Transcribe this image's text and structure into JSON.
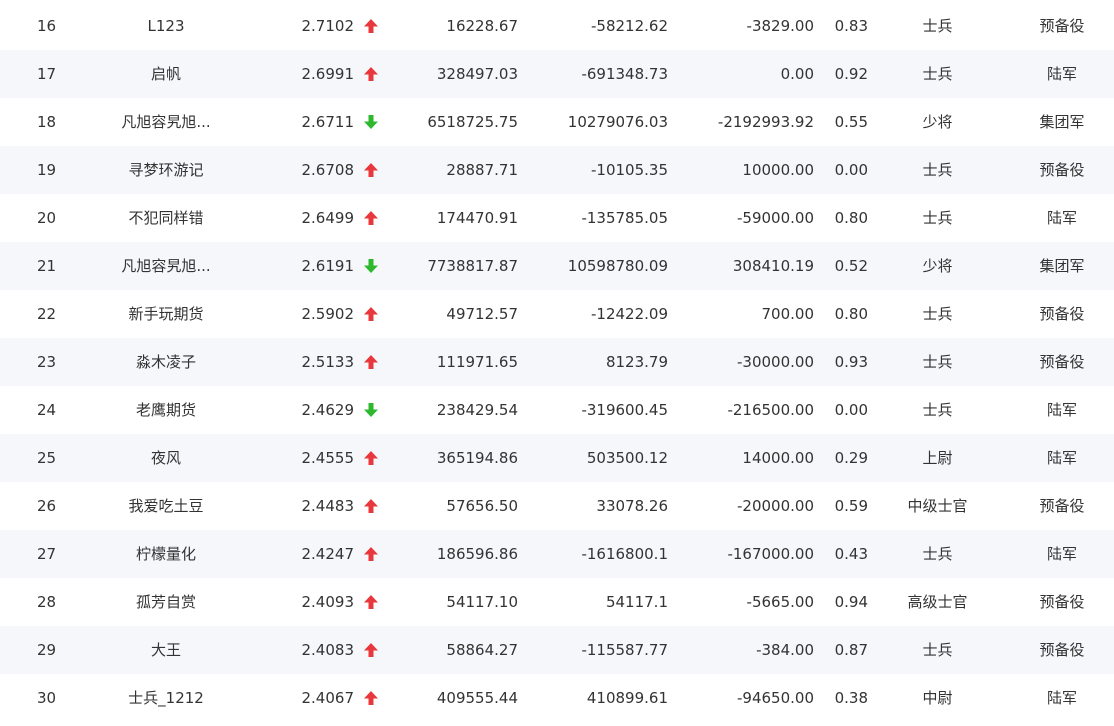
{
  "colors": {
    "up": "#e8383d",
    "down": "#2eb82e",
    "text": "#333333",
    "stripe": "#f5f7fa"
  },
  "rows": [
    {
      "rank": "16",
      "name": "L123",
      "score": "2.7102",
      "trend": "up",
      "trend_icon": "arrow-up-icon",
      "v1": "16228.67",
      "v2": "-58212.62",
      "v3": "-3829.00",
      "ratio": "0.83",
      "title": "士兵",
      "unit": "预备役"
    },
    {
      "rank": "17",
      "name": "启帆",
      "score": "2.6991",
      "trend": "up",
      "trend_icon": "arrow-up-icon",
      "v1": "328497.03",
      "v2": "-691348.73",
      "v3": "0.00",
      "ratio": "0.92",
      "title": "士兵",
      "unit": "陆军"
    },
    {
      "rank": "18",
      "name": "凡旭容旯旭...",
      "score": "2.6711",
      "trend": "down",
      "trend_icon": "arrow-down-icon",
      "v1": "6518725.75",
      "v2": "10279076.03",
      "v3": "-2192993.92",
      "ratio": "0.55",
      "title": "少将",
      "unit": "集团军"
    },
    {
      "rank": "19",
      "name": "寻梦环游记",
      "score": "2.6708",
      "trend": "up",
      "trend_icon": "arrow-up-icon",
      "v1": "28887.71",
      "v2": "-10105.35",
      "v3": "10000.00",
      "ratio": "0.00",
      "title": "士兵",
      "unit": "预备役"
    },
    {
      "rank": "20",
      "name": "不犯同样错",
      "score": "2.6499",
      "trend": "up",
      "trend_icon": "arrow-up-icon",
      "v1": "174470.91",
      "v2": "-135785.05",
      "v3": "-59000.00",
      "ratio": "0.80",
      "title": "士兵",
      "unit": "陆军"
    },
    {
      "rank": "21",
      "name": "凡旭容旯旭...",
      "score": "2.6191",
      "trend": "down",
      "trend_icon": "arrow-down-icon",
      "v1": "7738817.87",
      "v2": "10598780.09",
      "v3": "308410.19",
      "ratio": "0.52",
      "title": "少将",
      "unit": "集团军"
    },
    {
      "rank": "22",
      "name": "新手玩期货",
      "score": "2.5902",
      "trend": "up",
      "trend_icon": "arrow-up-icon",
      "v1": "49712.57",
      "v2": "-12422.09",
      "v3": "700.00",
      "ratio": "0.80",
      "title": "士兵",
      "unit": "预备役"
    },
    {
      "rank": "23",
      "name": "淼木凌子",
      "score": "2.5133",
      "trend": "up",
      "trend_icon": "arrow-up-icon",
      "v1": "111971.65",
      "v2": "8123.79",
      "v3": "-30000.00",
      "ratio": "0.93",
      "title": "士兵",
      "unit": "预备役"
    },
    {
      "rank": "24",
      "name": "老鹰期货",
      "score": "2.4629",
      "trend": "down",
      "trend_icon": "arrow-down-icon",
      "v1": "238429.54",
      "v2": "-319600.45",
      "v3": "-216500.00",
      "ratio": "0.00",
      "title": "士兵",
      "unit": "陆军"
    },
    {
      "rank": "25",
      "name": "夜风",
      "score": "2.4555",
      "trend": "up",
      "trend_icon": "arrow-up-icon",
      "v1": "365194.86",
      "v2": "503500.12",
      "v3": "14000.00",
      "ratio": "0.29",
      "title": "上尉",
      "unit": "陆军"
    },
    {
      "rank": "26",
      "name": "我爱吃土豆",
      "score": "2.4483",
      "trend": "up",
      "trend_icon": "arrow-up-icon",
      "v1": "57656.50",
      "v2": "33078.26",
      "v3": "-20000.00",
      "ratio": "0.59",
      "title": "中级士官",
      "unit": "预备役"
    },
    {
      "rank": "27",
      "name": "柠檬量化",
      "score": "2.4247",
      "trend": "up",
      "trend_icon": "arrow-up-icon",
      "v1": "186596.86",
      "v2": "-1616800.1",
      "v3": "-167000.00",
      "ratio": "0.43",
      "title": "士兵",
      "unit": "陆军"
    },
    {
      "rank": "28",
      "name": "孤芳自赏",
      "score": "2.4093",
      "trend": "up",
      "trend_icon": "arrow-up-icon",
      "v1": "54117.10",
      "v2": "54117.1",
      "v3": "-5665.00",
      "ratio": "0.94",
      "title": "高级士官",
      "unit": "预备役"
    },
    {
      "rank": "29",
      "name": "大王",
      "score": "2.4083",
      "trend": "up",
      "trend_icon": "arrow-up-icon",
      "v1": "58864.27",
      "v2": "-115587.77",
      "v3": "-384.00",
      "ratio": "0.87",
      "title": "士兵",
      "unit": "预备役"
    },
    {
      "rank": "30",
      "name": "士兵_1212",
      "score": "2.4067",
      "trend": "up",
      "trend_icon": "arrow-up-icon",
      "v1": "409555.44",
      "v2": "410899.61",
      "v3": "-94650.00",
      "ratio": "0.38",
      "title": "中尉",
      "unit": "陆军"
    }
  ]
}
